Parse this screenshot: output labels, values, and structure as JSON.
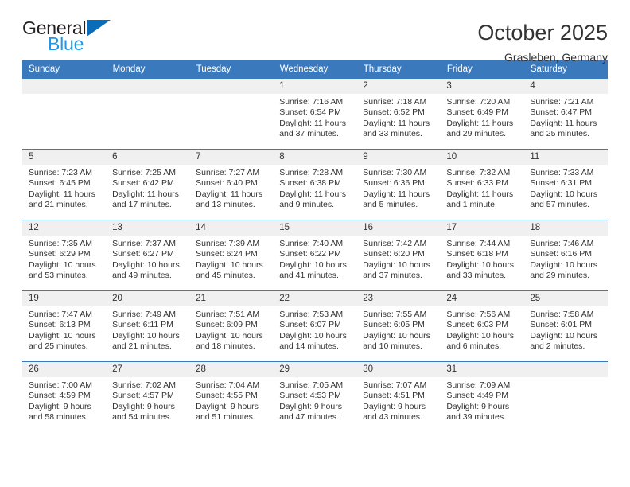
{
  "brand": {
    "word1": "General",
    "word2": "Blue",
    "triangle_color": "#0b6cb7",
    "blue_text_color": "#2196e3"
  },
  "header": {
    "title": "October 2025",
    "location": "Grasleben, Germany"
  },
  "theme": {
    "header_blue": "#3b79bd",
    "date_strip_gray": "#f0f0f0",
    "text": "#333333"
  },
  "calendar": {
    "weekday_headers": [
      "Sunday",
      "Monday",
      "Tuesday",
      "Wednesday",
      "Thursday",
      "Friday",
      "Saturday"
    ],
    "labels": {
      "sunrise": "Sunrise:",
      "sunset": "Sunset:",
      "daylight": "Daylight:"
    },
    "weeks": [
      [
        {
          "day": "",
          "detail": ""
        },
        {
          "day": "",
          "detail": ""
        },
        {
          "day": "",
          "detail": ""
        },
        {
          "day": "1",
          "detail": "Sunrise: 7:16 AM\nSunset: 6:54 PM\nDaylight: 11 hours and 37 minutes."
        },
        {
          "day": "2",
          "detail": "Sunrise: 7:18 AM\nSunset: 6:52 PM\nDaylight: 11 hours and 33 minutes."
        },
        {
          "day": "3",
          "detail": "Sunrise: 7:20 AM\nSunset: 6:49 PM\nDaylight: 11 hours and 29 minutes."
        },
        {
          "day": "4",
          "detail": "Sunrise: 7:21 AM\nSunset: 6:47 PM\nDaylight: 11 hours and 25 minutes."
        }
      ],
      [
        {
          "day": "5",
          "detail": "Sunrise: 7:23 AM\nSunset: 6:45 PM\nDaylight: 11 hours and 21 minutes."
        },
        {
          "day": "6",
          "detail": "Sunrise: 7:25 AM\nSunset: 6:42 PM\nDaylight: 11 hours and 17 minutes."
        },
        {
          "day": "7",
          "detail": "Sunrise: 7:27 AM\nSunset: 6:40 PM\nDaylight: 11 hours and 13 minutes."
        },
        {
          "day": "8",
          "detail": "Sunrise: 7:28 AM\nSunset: 6:38 PM\nDaylight: 11 hours and 9 minutes."
        },
        {
          "day": "9",
          "detail": "Sunrise: 7:30 AM\nSunset: 6:36 PM\nDaylight: 11 hours and 5 minutes."
        },
        {
          "day": "10",
          "detail": "Sunrise: 7:32 AM\nSunset: 6:33 PM\nDaylight: 11 hours and 1 minute."
        },
        {
          "day": "11",
          "detail": "Sunrise: 7:33 AM\nSunset: 6:31 PM\nDaylight: 10 hours and 57 minutes."
        }
      ],
      [
        {
          "day": "12",
          "detail": "Sunrise: 7:35 AM\nSunset: 6:29 PM\nDaylight: 10 hours and 53 minutes."
        },
        {
          "day": "13",
          "detail": "Sunrise: 7:37 AM\nSunset: 6:27 PM\nDaylight: 10 hours and 49 minutes."
        },
        {
          "day": "14",
          "detail": "Sunrise: 7:39 AM\nSunset: 6:24 PM\nDaylight: 10 hours and 45 minutes."
        },
        {
          "day": "15",
          "detail": "Sunrise: 7:40 AM\nSunset: 6:22 PM\nDaylight: 10 hours and 41 minutes."
        },
        {
          "day": "16",
          "detail": "Sunrise: 7:42 AM\nSunset: 6:20 PM\nDaylight: 10 hours and 37 minutes."
        },
        {
          "day": "17",
          "detail": "Sunrise: 7:44 AM\nSunset: 6:18 PM\nDaylight: 10 hours and 33 minutes."
        },
        {
          "day": "18",
          "detail": "Sunrise: 7:46 AM\nSunset: 6:16 PM\nDaylight: 10 hours and 29 minutes."
        }
      ],
      [
        {
          "day": "19",
          "detail": "Sunrise: 7:47 AM\nSunset: 6:13 PM\nDaylight: 10 hours and 25 minutes."
        },
        {
          "day": "20",
          "detail": "Sunrise: 7:49 AM\nSunset: 6:11 PM\nDaylight: 10 hours and 21 minutes."
        },
        {
          "day": "21",
          "detail": "Sunrise: 7:51 AM\nSunset: 6:09 PM\nDaylight: 10 hours and 18 minutes."
        },
        {
          "day": "22",
          "detail": "Sunrise: 7:53 AM\nSunset: 6:07 PM\nDaylight: 10 hours and 14 minutes."
        },
        {
          "day": "23",
          "detail": "Sunrise: 7:55 AM\nSunset: 6:05 PM\nDaylight: 10 hours and 10 minutes."
        },
        {
          "day": "24",
          "detail": "Sunrise: 7:56 AM\nSunset: 6:03 PM\nDaylight: 10 hours and 6 minutes."
        },
        {
          "day": "25",
          "detail": "Sunrise: 7:58 AM\nSunset: 6:01 PM\nDaylight: 10 hours and 2 minutes."
        }
      ],
      [
        {
          "day": "26",
          "detail": "Sunrise: 7:00 AM\nSunset: 4:59 PM\nDaylight: 9 hours and 58 minutes."
        },
        {
          "day": "27",
          "detail": "Sunrise: 7:02 AM\nSunset: 4:57 PM\nDaylight: 9 hours and 54 minutes."
        },
        {
          "day": "28",
          "detail": "Sunrise: 7:04 AM\nSunset: 4:55 PM\nDaylight: 9 hours and 51 minutes."
        },
        {
          "day": "29",
          "detail": "Sunrise: 7:05 AM\nSunset: 4:53 PM\nDaylight: 9 hours and 47 minutes."
        },
        {
          "day": "30",
          "detail": "Sunrise: 7:07 AM\nSunset: 4:51 PM\nDaylight: 9 hours and 43 minutes."
        },
        {
          "day": "31",
          "detail": "Sunrise: 7:09 AM\nSunset: 4:49 PM\nDaylight: 9 hours and 39 minutes."
        },
        {
          "day": "",
          "detail": ""
        }
      ]
    ]
  }
}
